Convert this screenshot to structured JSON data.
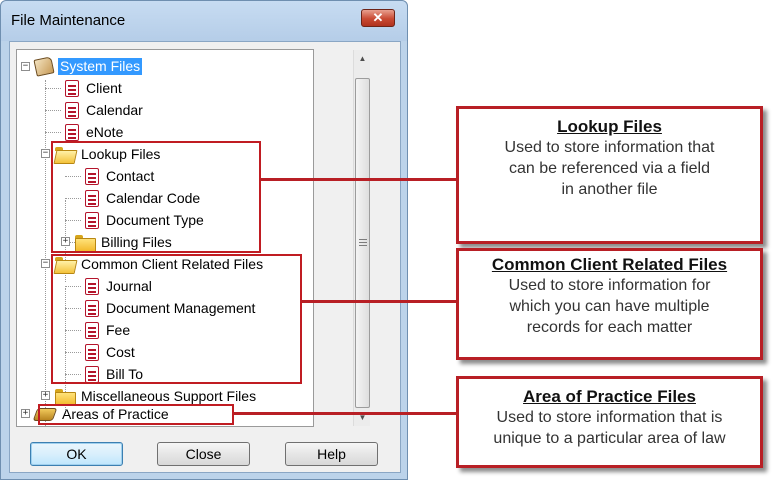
{
  "window": {
    "title": "File Maintenance",
    "close_glyph": "✕"
  },
  "tree": {
    "nodes": [
      {
        "label": "System Files",
        "icon": "book-icon",
        "selected": true
      },
      {
        "label": "Client",
        "icon": "document-icon"
      },
      {
        "label": "Calendar",
        "icon": "document-icon"
      },
      {
        "label": "eNote",
        "icon": "document-icon"
      },
      {
        "label": "Lookup Files",
        "icon": "folder-open-icon"
      },
      {
        "label": "Contact",
        "icon": "document-icon"
      },
      {
        "label": "Calendar Code",
        "icon": "document-icon"
      },
      {
        "label": "Document Type",
        "icon": "document-icon"
      },
      {
        "label": "Billing Files",
        "icon": "folder-icon"
      },
      {
        "label": "Common Client Related Files",
        "icon": "folder-open-icon"
      },
      {
        "label": "Journal",
        "icon": "document-icon"
      },
      {
        "label": "Document Management",
        "icon": "document-icon"
      },
      {
        "label": "Fee",
        "icon": "document-icon"
      },
      {
        "label": "Cost",
        "icon": "document-icon"
      },
      {
        "label": "Bill To",
        "icon": "document-icon"
      },
      {
        "label": "Miscellaneous Support Files",
        "icon": "folder-icon"
      },
      {
        "label": "Areas of Practice",
        "icon": "practice-icon"
      }
    ],
    "expander_collapsed": "+",
    "expander_expanded": "−"
  },
  "scrollbar": {
    "up_glyph": "▲",
    "down_glyph": "▼"
  },
  "buttons": {
    "ok": "OK",
    "close": "Close",
    "help": "Help"
  },
  "callouts": {
    "lookup": {
      "title": "Lookup Files",
      "lines": [
        "Used to store information that",
        "can be referenced via a field",
        "in another file"
      ]
    },
    "common": {
      "title": "Common Client Related Files",
      "lines": [
        "Used to store information for",
        "which you can have multiple",
        "records for each matter"
      ]
    },
    "practice": {
      "title": "Area of Practice Files",
      "lines": [
        "Used to store information that is",
        "unique to a particular area of law"
      ]
    }
  },
  "colors": {
    "highlight": "#c01c22",
    "selection": "#3399ff"
  }
}
